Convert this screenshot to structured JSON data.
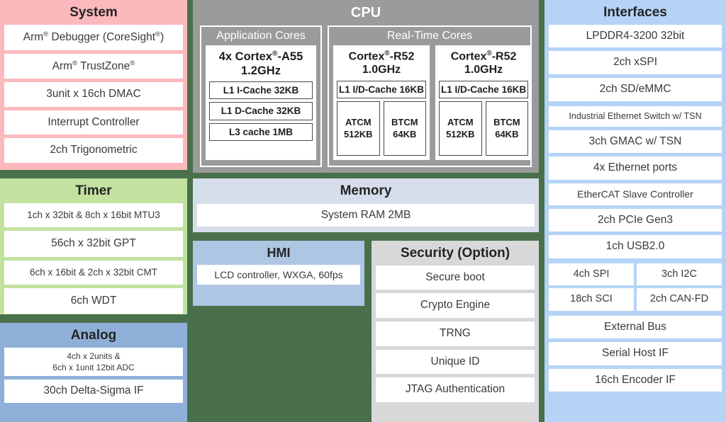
{
  "colors": {
    "background": "#49704b",
    "system": "#fbb9bd",
    "timer": "#c3e2a0",
    "analog": "#8eb0d8",
    "cpu": "#9b9b9b",
    "memory": "#d5deea",
    "hmi": "#aec5e3",
    "security": "#d8d8d8",
    "interfaces": "#b5d3f7",
    "cell": "#ffffff"
  },
  "system": {
    "title": "System",
    "items": [
      "Arm® Debugger (CoreSight®)",
      "Arm® TrustZone®",
      "3unit x 16ch DMAC",
      "Interrupt Controller",
      "2ch Trigonometric"
    ]
  },
  "timer": {
    "title": "Timer",
    "items": [
      "1ch x 32bit & 8ch x 16bit MTU3",
      "56ch x 32bit GPT",
      "6ch x 16bit & 2ch x 32bit CMT",
      "6ch WDT"
    ]
  },
  "analog": {
    "title": "Analog",
    "items": [
      "4ch x 2units &\n6ch x 1unit 12bit ADC",
      "30ch Delta-Sigma IF"
    ]
  },
  "cpu": {
    "title": "CPU",
    "application_cores": {
      "title": "Application Cores",
      "core": {
        "name_prefix": "4x Cortex",
        "name_suffix": "-A55",
        "frequency": "1.2GHz",
        "caches": [
          "L1 I-Cache 32KB",
          "L1 D-Cache 32KB",
          "L3 cache 1MB"
        ]
      }
    },
    "realtime_cores": {
      "title": "Real-Time Cores",
      "cores": [
        {
          "name_prefix": "Cortex",
          "name_suffix": "-R52",
          "frequency": "1.0GHz",
          "cache": "L1 I/D-Cache 16KB",
          "tcm": [
            {
              "name": "ATCM",
              "size": "512KB"
            },
            {
              "name": "BTCM",
              "size": "64KB"
            }
          ]
        },
        {
          "name_prefix": "Cortex",
          "name_suffix": "-R52",
          "frequency": "1.0GHz",
          "cache": "L1 I/D-Cache 16KB",
          "tcm": [
            {
              "name": "ATCM",
              "size": "512KB"
            },
            {
              "name": "BTCM",
              "size": "64KB"
            }
          ]
        }
      ]
    }
  },
  "memory": {
    "title": "Memory",
    "items": [
      "System RAM 2MB"
    ]
  },
  "hmi": {
    "title": "HMI",
    "items": [
      "LCD controller, WXGA, 60fps"
    ]
  },
  "security": {
    "title": "Security (Option)",
    "items": [
      "Secure boot",
      "Crypto Engine",
      "TRNG",
      "Unique ID",
      "JTAG Authentication"
    ]
  },
  "interfaces": {
    "title": "Interfaces",
    "group_memory": [
      "LPDDR4-3200 32bit",
      "2ch xSPI",
      "2ch SD/eMMC"
    ],
    "group_network": [
      "Industrial Ethernet Switch w/ TSN",
      "3ch GMAC w/ TSN",
      "4x Ethernet ports",
      "EtherCAT Slave Controller",
      "2ch PCIe Gen3",
      "1ch USB2.0"
    ],
    "group_serial": [
      "4ch SPI",
      "3ch I2C",
      "18ch SCI",
      "2ch CAN-FD"
    ],
    "group_bus": [
      "External Bus",
      "Serial Host IF",
      "16ch Encoder IF"
    ]
  }
}
